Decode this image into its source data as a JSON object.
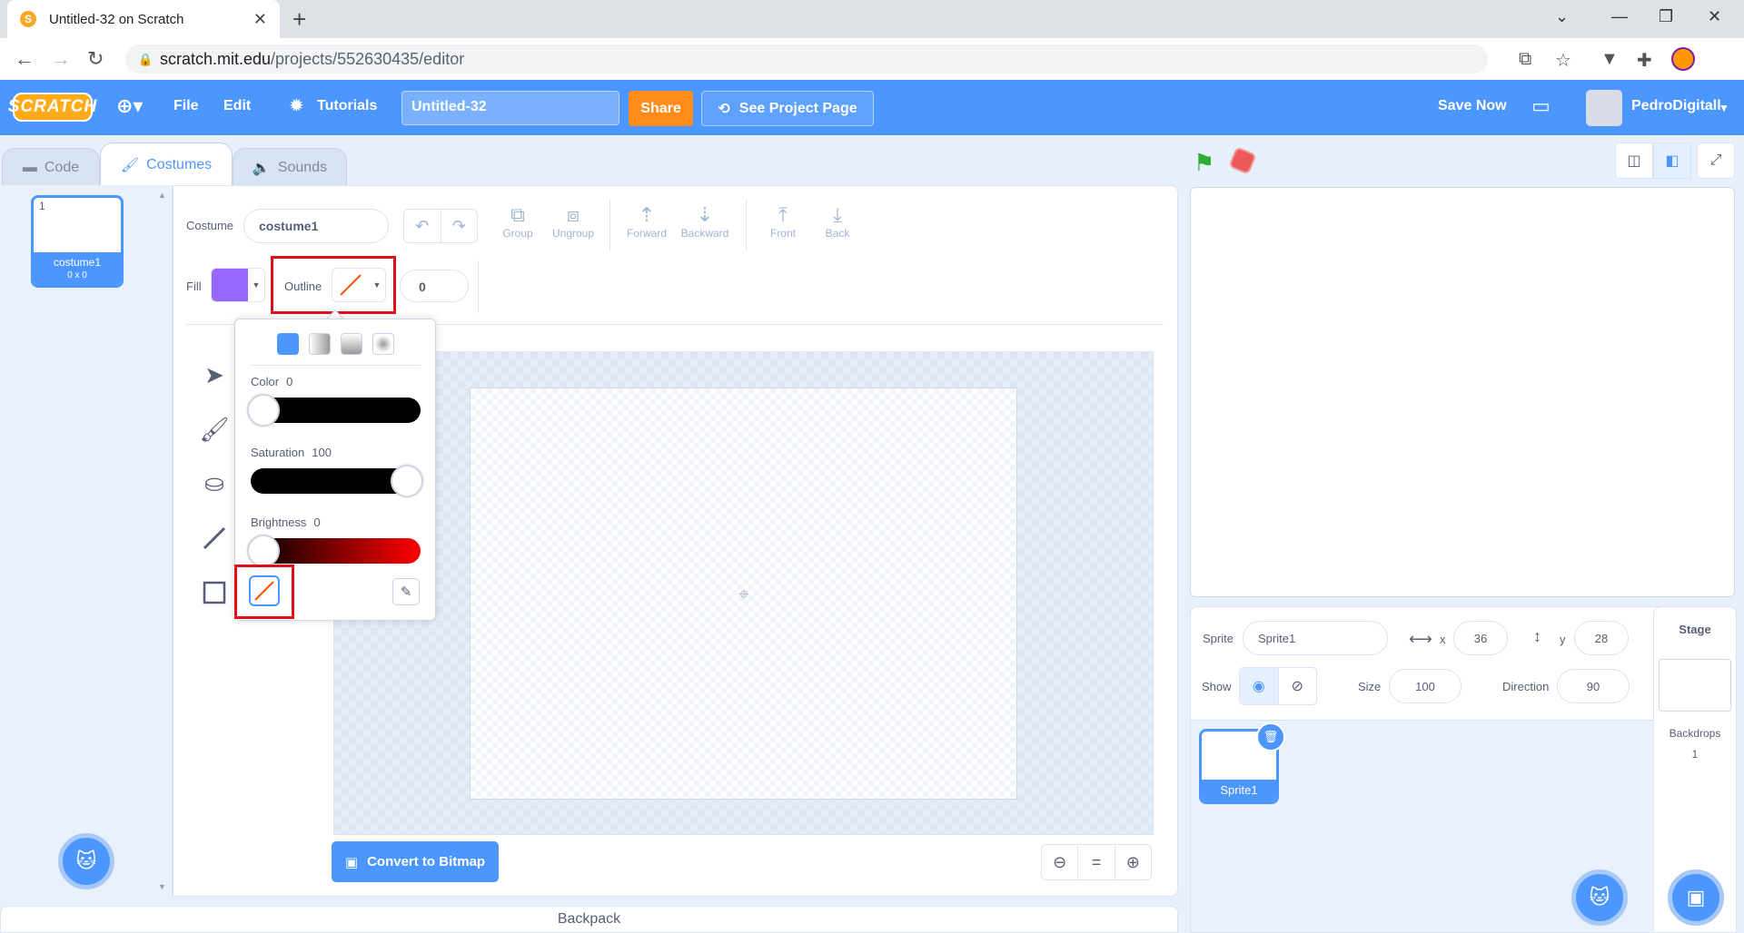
{
  "browser": {
    "tab_title": "Untitled-32 on Scratch",
    "url_host": "scratch.mit.edu",
    "url_path": "/projects/552630435/editor"
  },
  "menubar": {
    "logo": "SCRATCH",
    "file": "File",
    "edit": "Edit",
    "tutorials": "Tutorials",
    "project_title": "Untitled-32",
    "share": "Share",
    "see_project_page": "See Project Page",
    "save_now": "Save Now",
    "username": "PedroDigitall"
  },
  "editor_tabs": {
    "code": "Code",
    "costumes": "Costumes",
    "sounds": "Sounds"
  },
  "costume_list": [
    {
      "number": "1",
      "name": "costume1",
      "size": "0 x 0"
    }
  ],
  "paint_editor": {
    "costume_label": "Costume",
    "costume_name": "costume1",
    "toolbar": {
      "group": "Group",
      "ungroup": "Ungroup",
      "forward": "Forward",
      "backward": "Backward",
      "front": "Front",
      "back": "Back"
    },
    "fill_label": "Fill",
    "fill_color": "#9966ff",
    "outline_label": "Outline",
    "outline_width": "0",
    "convert_button": "Convert to Bitmap"
  },
  "color_picker": {
    "color_label": "Color",
    "color_value": "0",
    "color_value_fraction": 0.0,
    "saturation_label": "Saturation",
    "saturation_value": "100",
    "saturation_value_fraction": 1.0,
    "brightness_label": "Brightness",
    "brightness_value": "0",
    "brightness_value_fraction": 0.0
  },
  "sprite_info": {
    "sprite_label": "Sprite",
    "sprite_name": "Sprite1",
    "x_label": "x",
    "x_value": "36",
    "y_label": "y",
    "y_value": "28",
    "show_label": "Show",
    "size_label": "Size",
    "size_value": "100",
    "direction_label": "Direction",
    "direction_value": "90"
  },
  "sprites": [
    {
      "name": "Sprite1"
    }
  ],
  "stage_panel": {
    "title": "Stage",
    "backdrops_label": "Backdrops",
    "backdrops_count": "1"
  },
  "backpack": "Backpack",
  "colors": {
    "accent": "#4c97ff",
    "share": "#ff8c1a",
    "highlight": "#e0101a"
  }
}
